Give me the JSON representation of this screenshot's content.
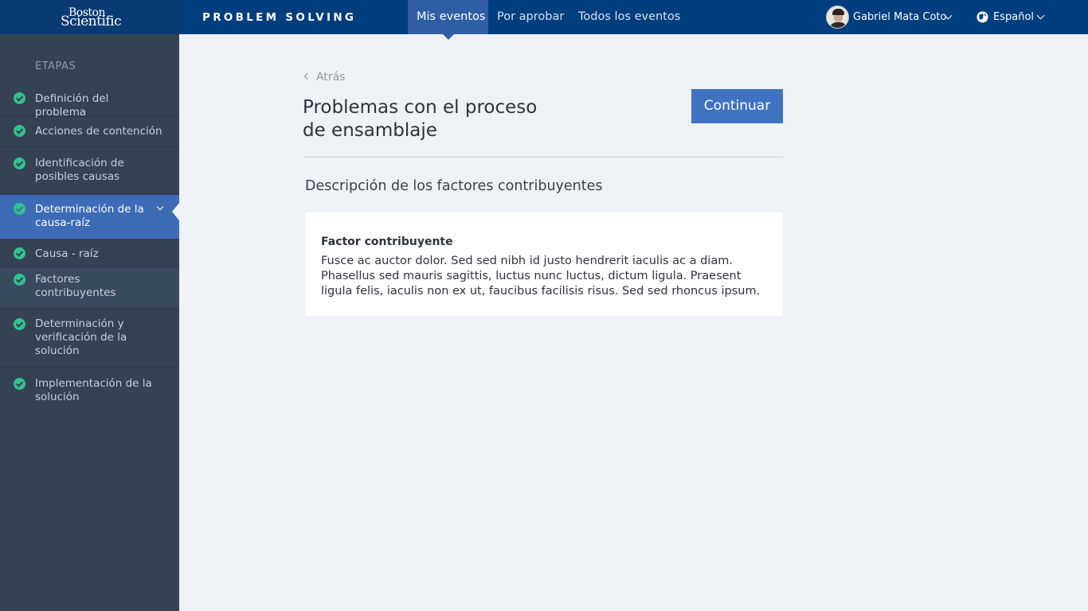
{
  "brand": {
    "logo_line1": "Boston",
    "logo_line2": "Scientific"
  },
  "header": {
    "app_title": "PROBLEM SOLVING",
    "tabs": [
      {
        "label": "Mis eventos",
        "active": true
      },
      {
        "label": "Por aprobar",
        "active": false
      },
      {
        "label": "Todos los eventos",
        "active": false
      }
    ],
    "user_name": "Gabriel Mata Coto",
    "language": "Español"
  },
  "sidebar": {
    "header": "ETAPAS",
    "items": [
      {
        "label": "Definición del problema",
        "status": "complete"
      },
      {
        "label": "Acciones de contención",
        "status": "complete"
      },
      {
        "label": "Identificación de posibles causas",
        "status": "complete"
      },
      {
        "label": "Determinación de la causa-raíz",
        "status": "complete",
        "active": true,
        "expanded": true
      },
      {
        "label": "Causa - raíz",
        "status": "complete",
        "sub": true
      },
      {
        "label": "Factores contribuyentes",
        "status": "complete",
        "sub": true,
        "selected": true
      },
      {
        "label": "Determinación y verificación de la solución",
        "status": "complete"
      },
      {
        "label": "Implementación de la solución",
        "status": "complete"
      }
    ]
  },
  "main": {
    "back_label": "Atrás",
    "title": "Problemas con el proceso de ensamblaje",
    "continue_label": "Continuar",
    "section_title": "Descripción de los factores contribuyentes",
    "card": {
      "label": "Factor contribuyente",
      "text": "Fusce ac auctor dolor. Sed sed nibh id justo hendrerit iaculis ac a diam. Phasellus sed mauris sagittis, luctus nunc luctus, dictum ligula. Praesent ligula felis, iaculis non ex ut, faucibus facilisis risus. Sed sed rhoncus ipsum."
    }
  },
  "colors": {
    "topbar": "#003e7e",
    "accent": "#3f72c1",
    "sidebar_bg": "#344254",
    "check": "#2fc38e",
    "page_bg": "#eef1f6"
  }
}
